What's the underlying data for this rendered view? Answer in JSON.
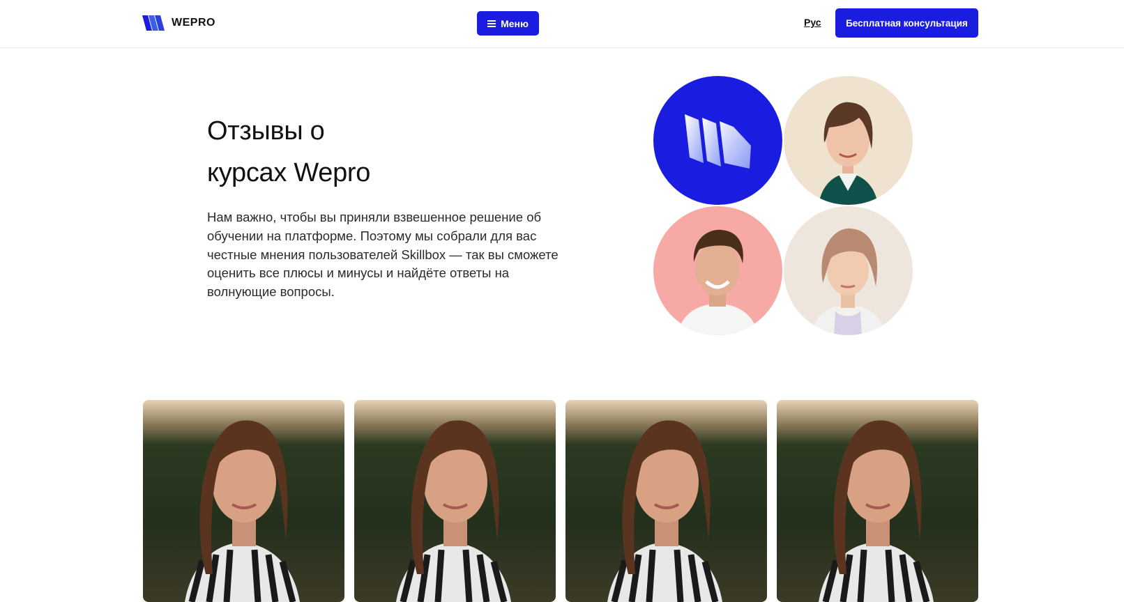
{
  "header": {
    "logo_text": "WEPRO",
    "menu_label": "Меню",
    "lang_label": "Рус",
    "consult_label": "Бесплатная консультация"
  },
  "hero": {
    "title_line1": "Отзывы о",
    "title_line2": "курсах Wepro",
    "description": "Нам важно, чтобы вы приняли взвешенное решение об обучении на платформе. Поэтому мы собрали для вас честные мнения пользователей Skillbox — так вы сможете оценить все плюсы и минусы и найдёте ответы на волнующие вопросы."
  },
  "icons": {
    "logo": "wepro-logo-icon",
    "menu": "hamburger-icon"
  },
  "colors": {
    "brand_blue": "#1a1de0",
    "circle_pink": "#f7a9a6",
    "circle_beige": "#efe3cf",
    "circle_cream": "#eee6dc"
  },
  "review_cards": [
    {
      "photo": "woman-portrait-photo"
    },
    {
      "photo": "woman-portrait-photo"
    },
    {
      "photo": "woman-portrait-photo"
    },
    {
      "photo": "woman-portrait-photo"
    }
  ]
}
